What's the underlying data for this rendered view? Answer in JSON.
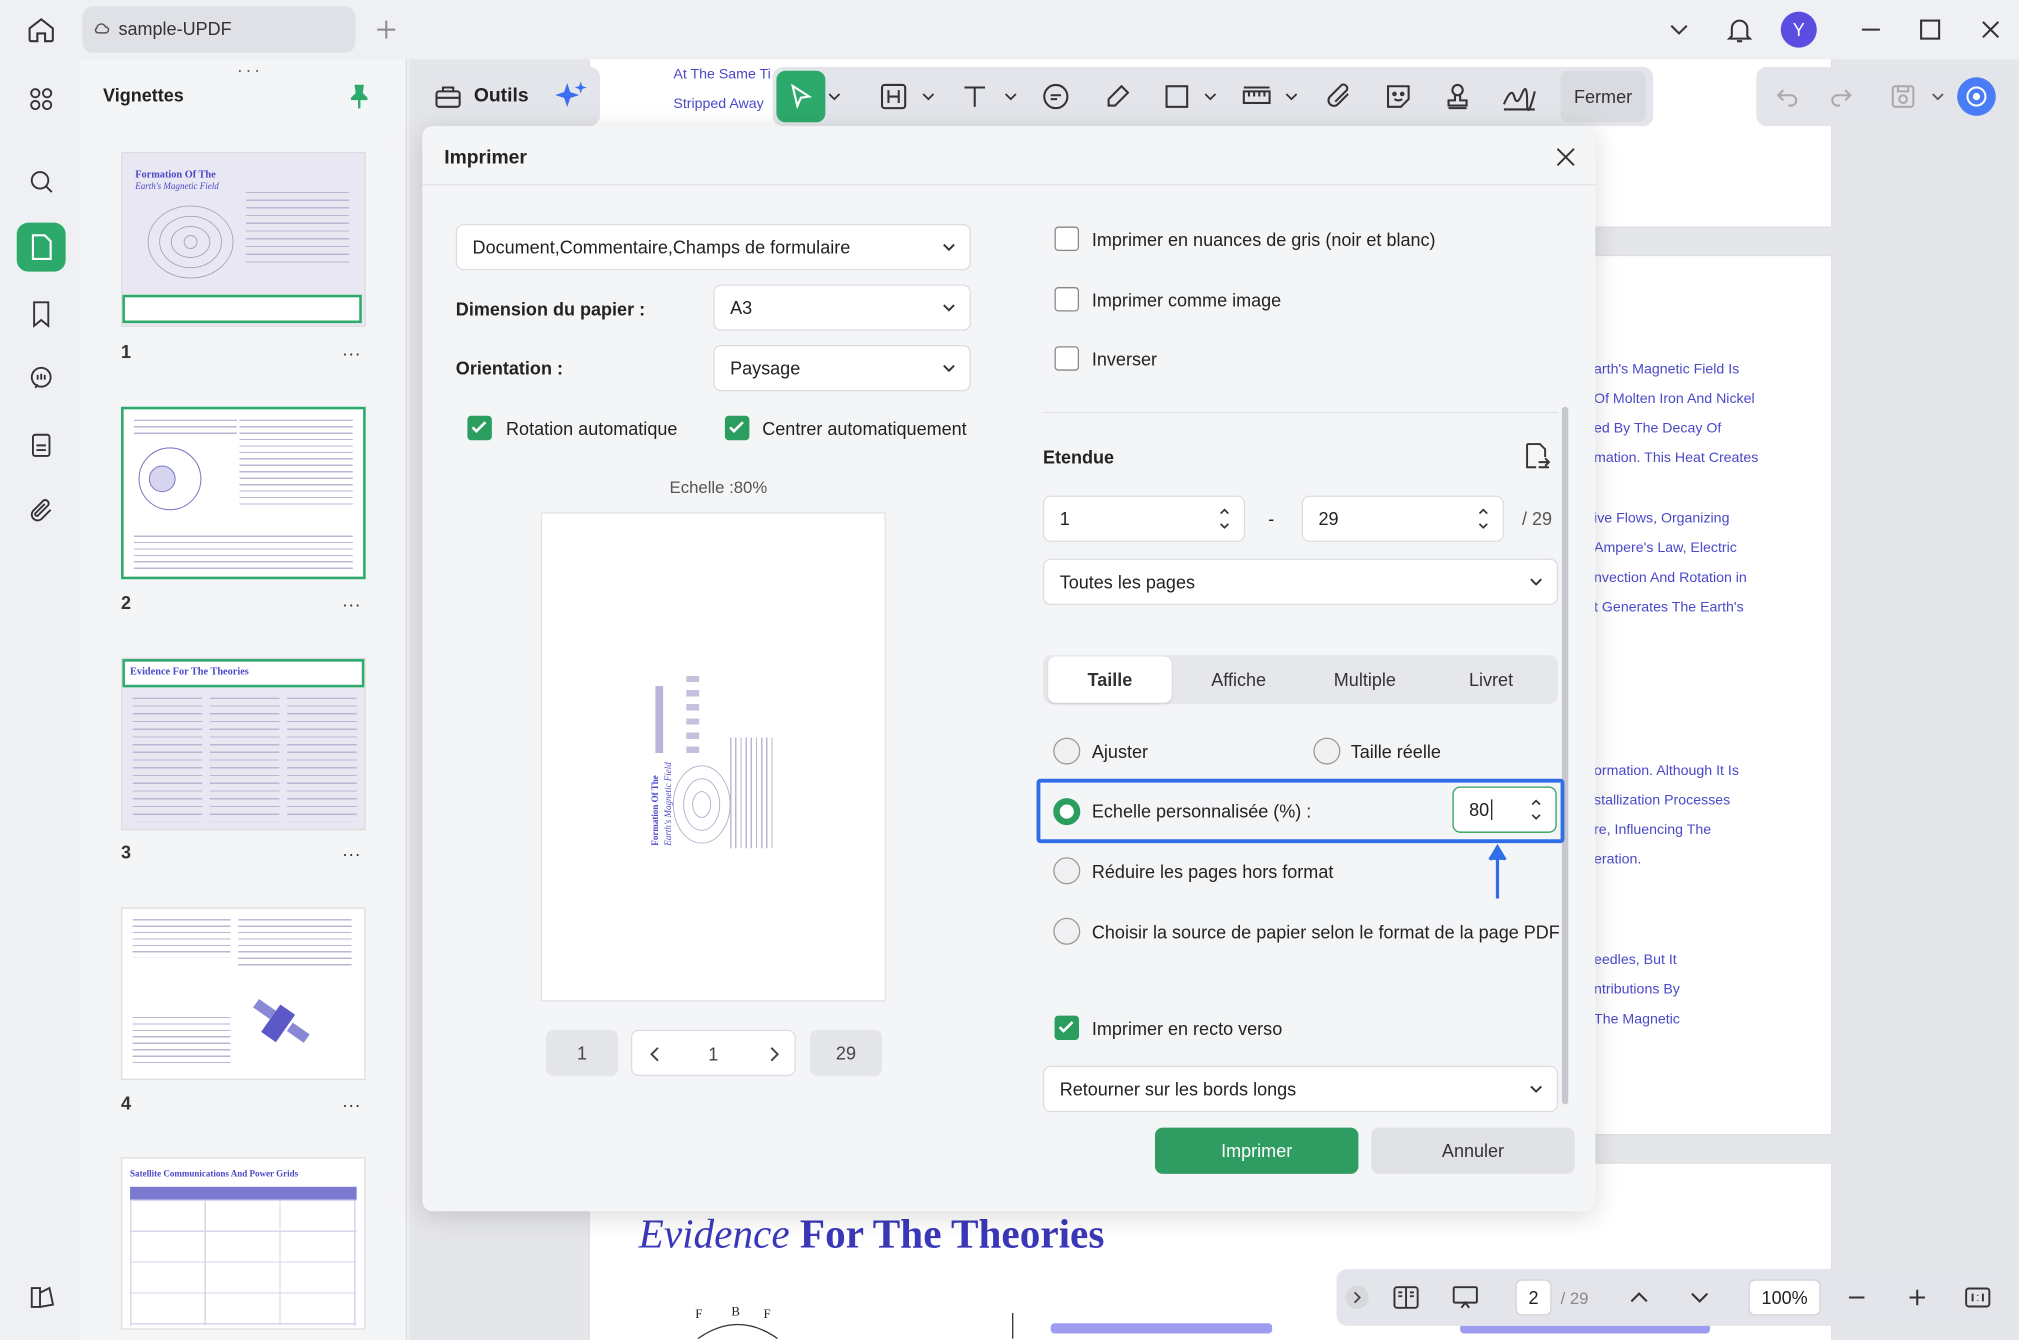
{
  "app": {
    "tab_title": "sample-UPDF",
    "avatar_letter": "Y",
    "accent": "#2daa6b"
  },
  "thumbnails": {
    "title": "Vignettes",
    "pages": [
      {
        "num": "1",
        "heading": "Formation Of The",
        "sub": "Earth's Magnetic Field"
      },
      {
        "num": "2",
        "heading": "",
        "sub": ""
      },
      {
        "num": "3",
        "heading": "Evidence For The Theories",
        "sub": ""
      },
      {
        "num": "4",
        "heading": "",
        "sub": ""
      },
      {
        "num": "",
        "heading": "Satellite Communications And Power Grids",
        "sub": ""
      }
    ],
    "more": "..."
  },
  "toolbar": {
    "tools_label": "Outils",
    "close_label": "Fermer"
  },
  "document": {
    "top_lines": [
      "At The Same Ti",
      "Stripped Away"
    ],
    "right_lines": [
      "arth's Magnetic Field Is",
      "Of Molten Iron And Nickel",
      "ed By The Decay Of",
      "mation. This Heat Creates",
      "ive Flows, Organizing",
      "Ampere's Law, Electric",
      "nvection And Rotation in",
      "t Generates The Earth's",
      "ormation. Although It Is",
      "stallization Processes",
      "re, Influencing The",
      "eration.",
      "eedles, But It",
      "ntributions By",
      "The Magnetic"
    ],
    "heading_italic": "Evidence",
    "heading_bold": "For The Theories",
    "diagram_labels": [
      "F",
      "B",
      "F"
    ]
  },
  "dialog": {
    "title": "Imprimer",
    "content_select": "Document,Commentaire,Champs de formulaire",
    "paper_label": "Dimension du papier :",
    "paper_value": "A3",
    "orientation_label": "Orientation :",
    "orientation_value": "Paysage",
    "auto_rotate": "Rotation automatique",
    "auto_center": "Centrer automatiquement",
    "scale_caption": "Echelle :80%",
    "preview_title_a": "Formation Of The",
    "preview_title_b": "Earth's Magnetic Field",
    "pager": {
      "first": "1",
      "current": "1",
      "last": "29"
    },
    "grayscale": "Imprimer en nuances de gris (noir et blanc)",
    "as_image": "Imprimer comme image",
    "invert": "Inverser",
    "range_title": "Etendue",
    "range_from": "1",
    "range_sep": "-",
    "range_to": "29",
    "range_total": "/ 29",
    "pages_select": "Toutes les pages",
    "tabs": [
      "Taille",
      "Affiche",
      "Multiple",
      "Livret"
    ],
    "fit": "Ajuster",
    "actual": "Taille réelle",
    "custom_scale": "Echelle personnalisée (%) :",
    "custom_scale_value": "80",
    "shrink": "Réduire les pages hors format",
    "paper_source": "Choisir la source de papier selon le format de la page PDF",
    "duplex": "Imprimer en recto verso",
    "duplex_mode": "Retourner sur les bords longs",
    "print_btn": "Imprimer",
    "cancel_btn": "Annuler"
  },
  "bottom_nav": {
    "page": "2",
    "total": "/ 29",
    "zoom": "100%"
  }
}
